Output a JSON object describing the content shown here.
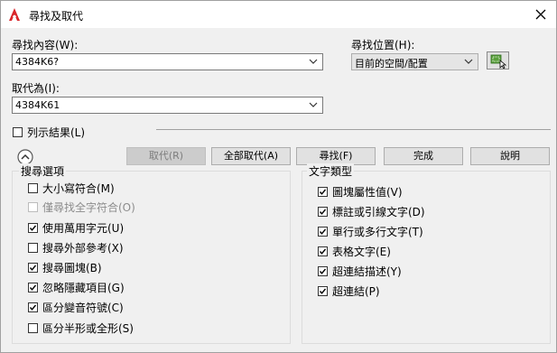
{
  "window": {
    "title": "尋找及取代"
  },
  "find": {
    "label": "尋找內容(W):",
    "value": "4384K6?"
  },
  "replace": {
    "label": "取代為(I):",
    "value": "4384K61"
  },
  "find_where": {
    "label": "尋找位置(H):",
    "value": "目前的空間/配置"
  },
  "list_results": {
    "label": "列示結果(L)",
    "checked": false
  },
  "buttons": {
    "replace": "取代(R)",
    "replace_all": "全部取代(A)",
    "find": "尋找(F)",
    "done": "完成",
    "help": "說明"
  },
  "search_options": {
    "title": "搜尋選項",
    "items": [
      {
        "label": "大小寫符合(M)",
        "checked": false,
        "disabled": false
      },
      {
        "label": "僅尋找全字符合(O)",
        "checked": false,
        "disabled": true
      },
      {
        "label": "使用萬用字元(U)",
        "checked": true,
        "disabled": false
      },
      {
        "label": "搜尋外部參考(X)",
        "checked": false,
        "disabled": false
      },
      {
        "label": "搜尋圖塊(B)",
        "checked": true,
        "disabled": false
      },
      {
        "label": "忽略隱藏項目(G)",
        "checked": true,
        "disabled": false
      },
      {
        "label": "區分變音符號(C)",
        "checked": true,
        "disabled": false
      },
      {
        "label": "區分半形或全形(S)",
        "checked": false,
        "disabled": false
      }
    ]
  },
  "text_types": {
    "title": "文字類型",
    "items": [
      {
        "label": "圖塊屬性值(V)",
        "checked": true
      },
      {
        "label": "標註或引線文字(D)",
        "checked": true
      },
      {
        "label": "單行或多行文字(T)",
        "checked": true
      },
      {
        "label": "表格文字(E)",
        "checked": true
      },
      {
        "label": "超連結描述(Y)",
        "checked": true
      },
      {
        "label": "超連結(P)",
        "checked": true
      }
    ]
  },
  "colors": {
    "brand": "#d9262a",
    "group_border": "#dcdcdc"
  }
}
